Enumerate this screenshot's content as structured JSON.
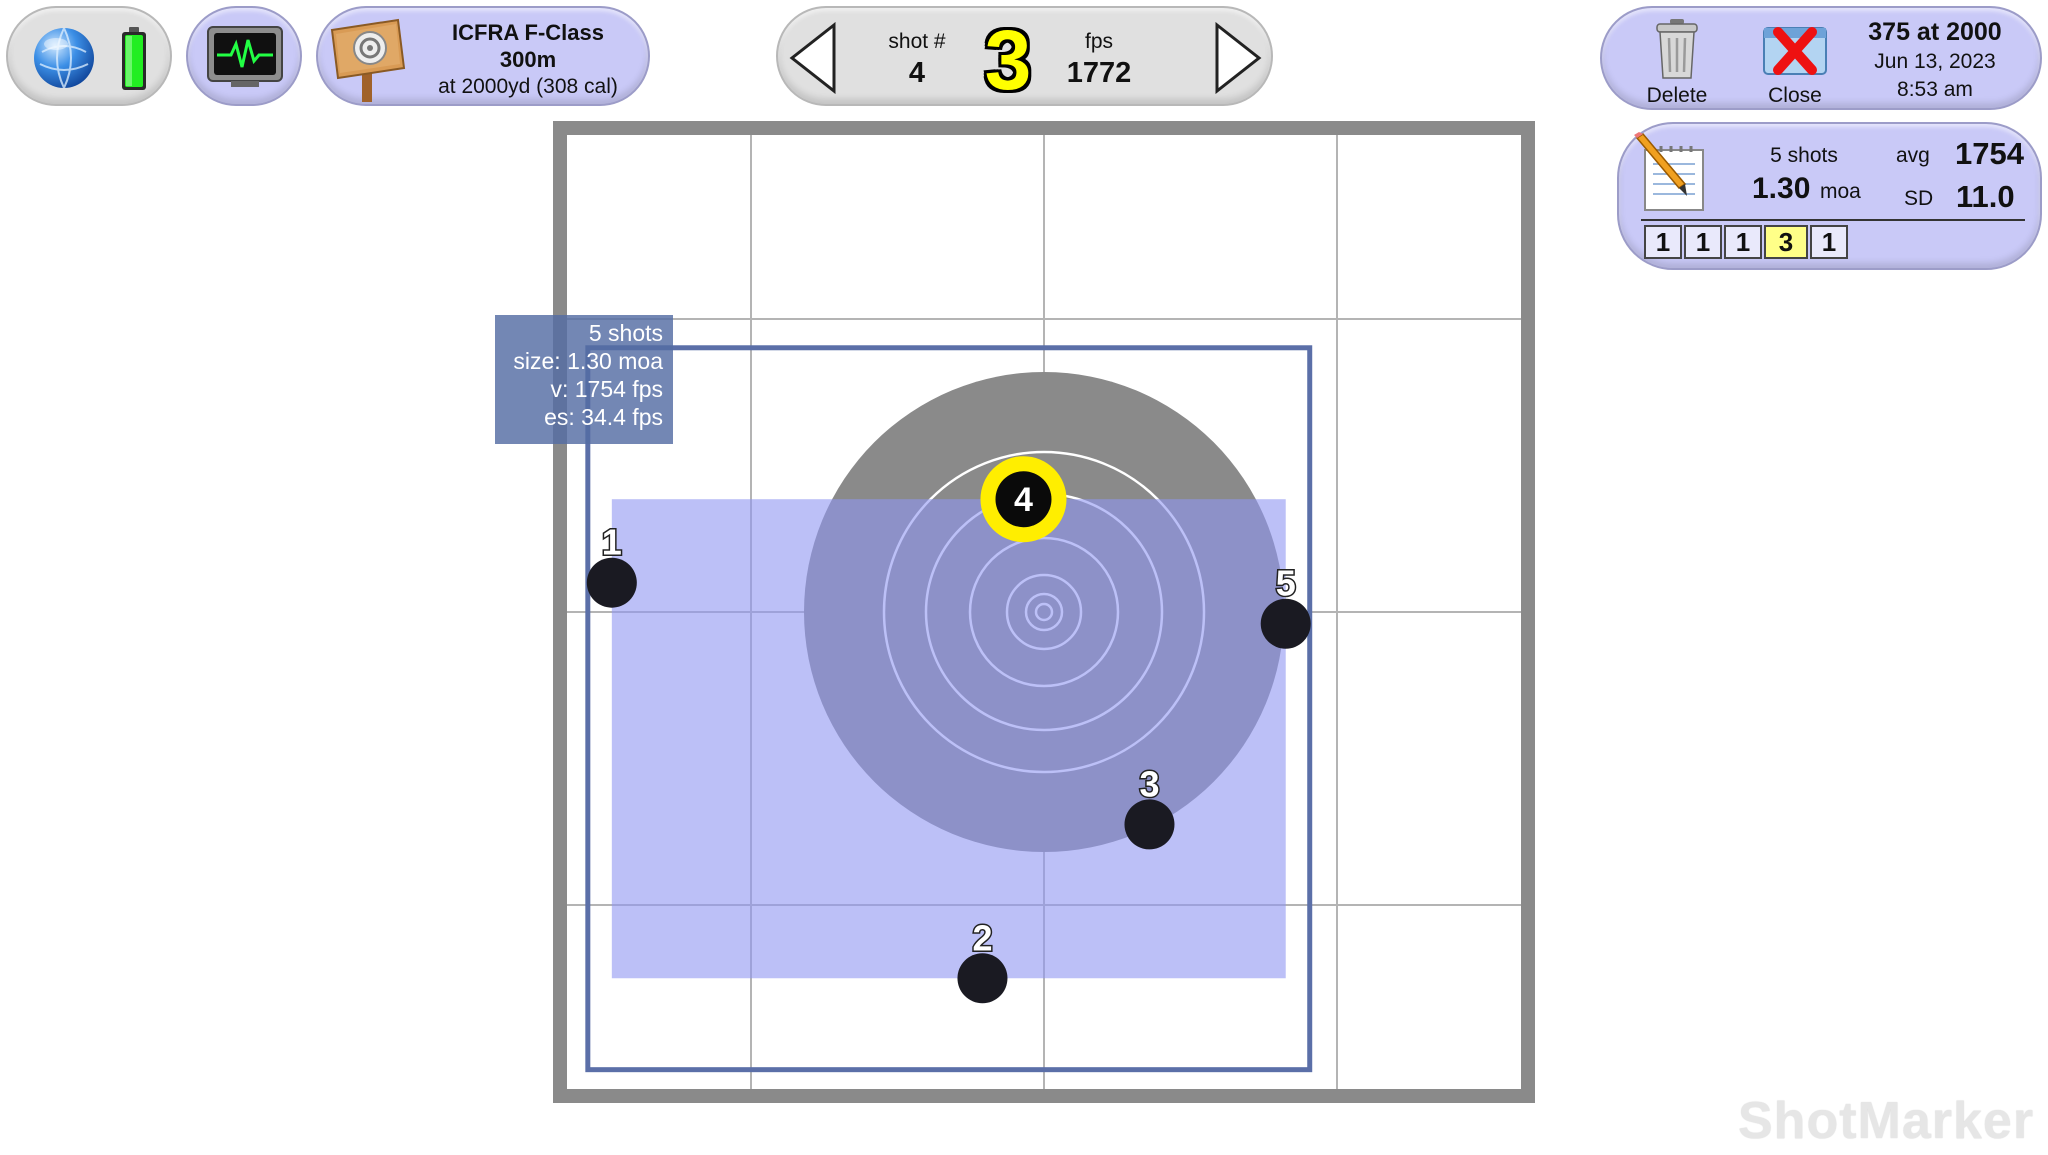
{
  "string": {
    "title": "ICFRA F-Class",
    "distance": "300m",
    "subtitle": "at 2000yd (308 cal)"
  },
  "shot": {
    "number_label": "shot #",
    "number": "4",
    "score": "3",
    "fps_label": "fps",
    "fps": "1772",
    "score_color": "#ffff00"
  },
  "actions": {
    "delete": "Delete",
    "close": "Close"
  },
  "session": {
    "name": "375 at 2000",
    "date": "Jun 13, 2023",
    "time": "8:53 am"
  },
  "summary": {
    "shots": "5 shots",
    "size": "1.30",
    "size_unit": "moa",
    "avg_label": "avg",
    "avg": "1754",
    "sd_label": "SD",
    "sd": "11.0",
    "scores": [
      "1",
      "1",
      "1",
      "3",
      "1"
    ],
    "selected_index": 3
  },
  "group_box": {
    "shots": "5 shots",
    "size": "size: 1.30 moa",
    "velocity": "v: 1754 fps",
    "es": "es: 34.4 fps"
  },
  "shots": [
    {
      "label": "1",
      "x": -2.95,
      "y": 0.2,
      "selected": false
    },
    {
      "label": "2",
      "x": -0.42,
      "y": -2.5,
      "selected": false
    },
    {
      "label": "3",
      "x": 0.72,
      "y": -1.45,
      "selected": false
    },
    {
      "label": "4",
      "x": -0.14,
      "y": 0.77,
      "selected": true
    },
    {
      "label": "5",
      "x": 1.65,
      "y": -0.08,
      "selected": false
    }
  ],
  "brand": "ShotMarker",
  "colors": {
    "panel": "#c9c9f7",
    "group_fill": "#8f96f2",
    "group_outline": "#5b6fa8",
    "target_black": "#8a8a8a",
    "selected_shot": "#ffee00"
  }
}
